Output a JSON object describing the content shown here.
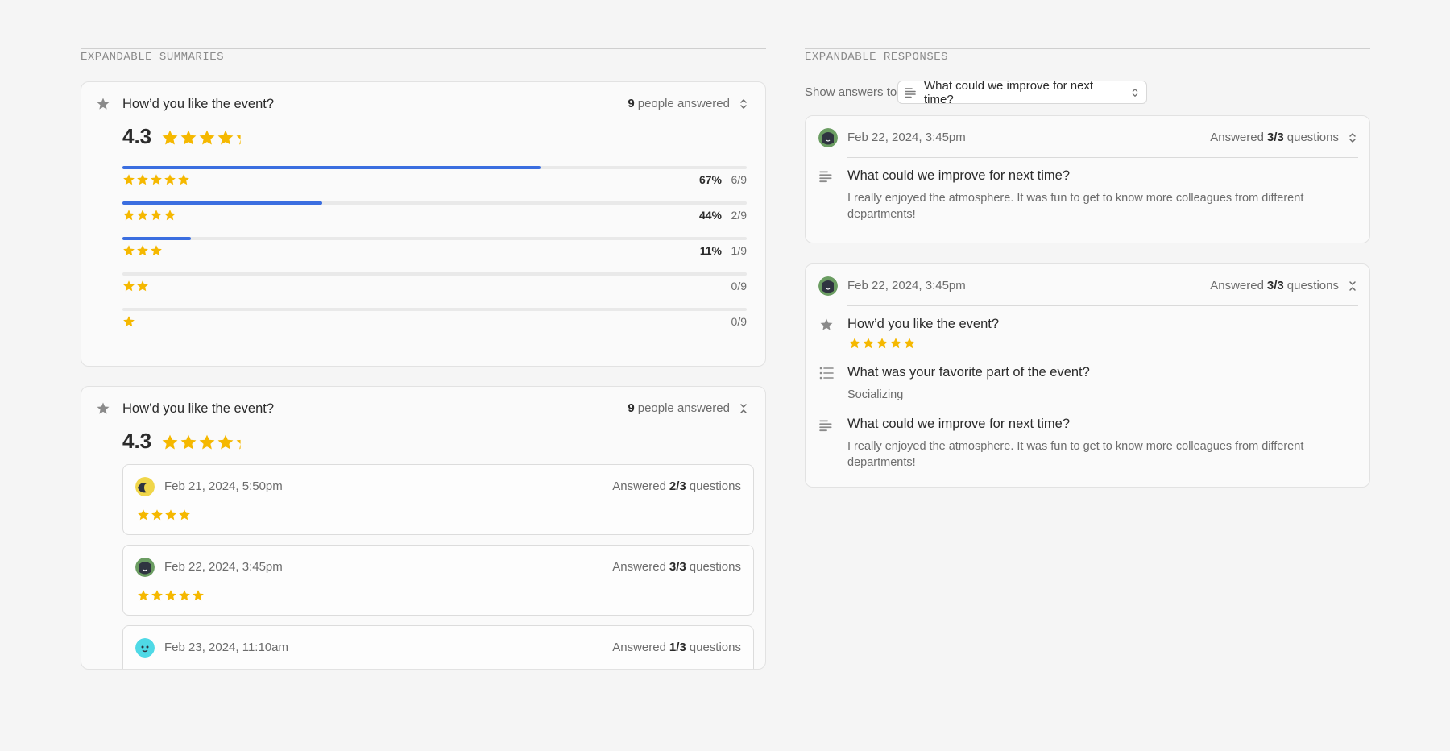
{
  "left": {
    "section_title": "EXPANDABLE SUMMARIES",
    "card1": {
      "question": "How’d you like the event?",
      "answered_count": "9",
      "answered_suffix": "people answered",
      "average": "4.3",
      "average_value": 4.3,
      "distribution": [
        {
          "stars": 5,
          "fill": 0.67,
          "pct": "67%",
          "count": "6/9"
        },
        {
          "stars": 4,
          "fill": 0.32,
          "pct": "44%",
          "count": "2/9"
        },
        {
          "stars": 3,
          "fill": 0.11,
          "pct": "11%",
          "count": "1/9"
        },
        {
          "stars": 2,
          "fill": 0,
          "pct": "",
          "count": "0/9"
        },
        {
          "stars": 1,
          "fill": 0,
          "pct": "",
          "count": "0/9"
        }
      ]
    },
    "card2": {
      "question": "How’d you like the event?",
      "answered_count": "9",
      "answered_suffix": "people answered",
      "average": "4.3",
      "responses": [
        {
          "date": "Feb 21, 2024, 5:50pm",
          "answered_prefix": "Answered",
          "answered": "2/3",
          "answered_suffix": "questions",
          "rating": 4,
          "avatar": "yellow-avatar"
        },
        {
          "date": "Feb 22, 2024, 3:45pm",
          "answered_prefix": "Answered",
          "answered": "3/3",
          "answered_suffix": "questions",
          "rating": 5,
          "avatar": "green-avatar"
        },
        {
          "date": "Feb 23, 2024, 11:10am",
          "answered_prefix": "Answered",
          "answered": "1/3",
          "answered_suffix": "questions",
          "rating": 0,
          "avatar": "cyan-avatar"
        }
      ]
    }
  },
  "right": {
    "section_title": "EXPANDABLE RESPONSES",
    "filter_label": "Show answers to",
    "filter_value": "What could we improve for next time?",
    "response1": {
      "date": "Feb 22, 2024, 3:45pm",
      "answered_prefix": "Answered",
      "answered": "3/3",
      "answered_suffix": "questions",
      "question": "What could we improve for next time?",
      "answer": "I really enjoyed the atmosphere. It was fun to get to know more colleagues from different departments!"
    },
    "response2": {
      "date": "Feb 22, 2024, 3:45pm",
      "answered_prefix": "Answered",
      "answered": "3/3",
      "answered_suffix": "questions",
      "q1": "How’d you like the event?",
      "q1_rating": 5,
      "q2": "What was your favorite part of the event?",
      "q2_answer": "Socializing",
      "q3": "What could we improve for next time?",
      "q3_answer": "I really enjoyed the atmosphere. It was fun to get to know more colleagues from different departments!"
    }
  },
  "colors": {
    "star": "#f5b800",
    "bar": "#3b6ee0",
    "track": "#e9e9e9"
  }
}
